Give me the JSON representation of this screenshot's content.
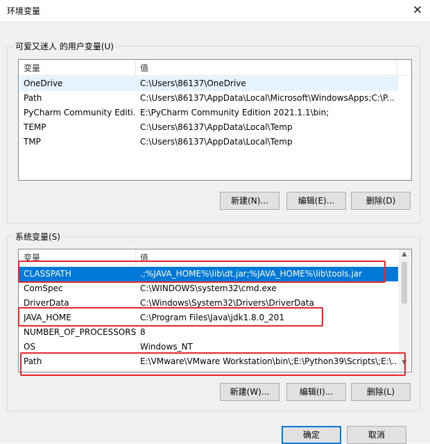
{
  "window": {
    "title": "环境变量",
    "close_glyph": "✕"
  },
  "user_vars": {
    "group_label": "可爱又迷人 的用户变量(U)",
    "col_name": "变量",
    "col_value": "值",
    "rows": [
      {
        "name": "OneDrive",
        "value": "C:\\Users\\86137\\OneDrive"
      },
      {
        "name": "Path",
        "value": "C:\\Users\\86137\\AppData\\Local\\Microsoft\\WindowsApps;C:\\P..."
      },
      {
        "name": "PyCharm Community Editi...",
        "value": "E:\\PyCharm Community Edition 2021.1.1\\bin;"
      },
      {
        "name": "TEMP",
        "value": "C:\\Users\\86137\\AppData\\Local\\Temp"
      },
      {
        "name": "TMP",
        "value": "C:\\Users\\86137\\AppData\\Local\\Temp"
      }
    ],
    "buttons": {
      "new": "新建(N)...",
      "edit": "编辑(E)...",
      "delete": "删除(D)"
    }
  },
  "sys_vars": {
    "group_label": "系统变量(S)",
    "col_name": "变量",
    "col_value": "值",
    "rows": [
      {
        "name": "CLASSPATH",
        "value": ".;%JAVA_HOME%\\lib\\dt.jar;%JAVA_HOME%\\lib\\tools.jar"
      },
      {
        "name": "ComSpec",
        "value": "C:\\WINDOWS\\system32\\cmd.exe"
      },
      {
        "name": "DriverData",
        "value": "C:\\Windows\\System32\\Drivers\\DriverData"
      },
      {
        "name": "JAVA_HOME",
        "value": "C:\\Program Files\\Java\\jdk1.8.0_201"
      },
      {
        "name": "NUMBER_OF_PROCESSORS",
        "value": "8"
      },
      {
        "name": "OS",
        "value": "Windows_NT"
      },
      {
        "name": "Path",
        "value": "E:\\VMware\\VMware Workstation\\bin\\;E:\\Python39\\Scripts\\;E:\\..."
      }
    ],
    "buttons": {
      "new": "新建(W)...",
      "edit": "编辑(I)...",
      "delete": "删除(L)"
    }
  },
  "footer": {
    "ok": "确定",
    "cancel": "取消"
  },
  "colors": {
    "selection": "#0078d7",
    "highlight_box": "#e8262b",
    "accent": "#0078d7"
  }
}
